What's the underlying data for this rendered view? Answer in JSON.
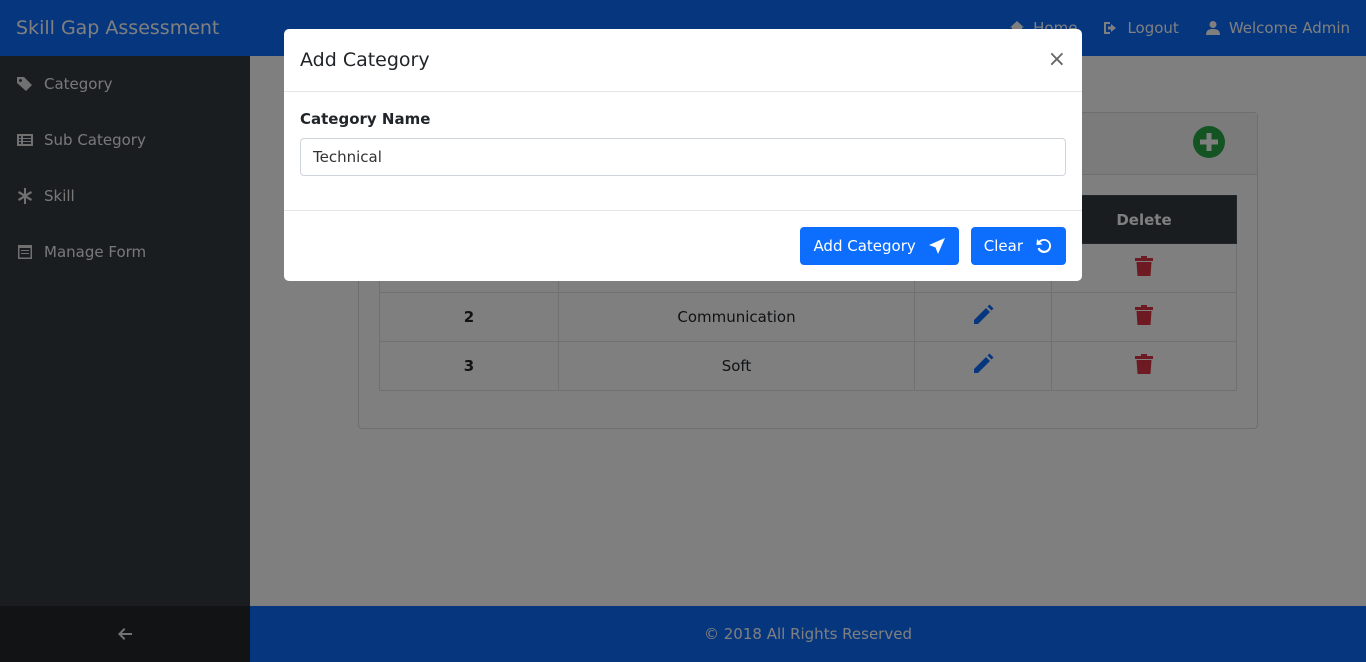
{
  "navbar": {
    "brand": "Skill Gap Assessment",
    "home_label": "Home",
    "logout_label": "Logout",
    "welcome_label": "Welcome Admin"
  },
  "sidebar": {
    "items": [
      {
        "label": "Category",
        "icon": "tags-icon"
      },
      {
        "label": "Sub Category",
        "icon": "list-icon"
      },
      {
        "label": "Skill",
        "icon": "asterisk-icon"
      },
      {
        "label": "Manage Form",
        "icon": "form-icon"
      }
    ],
    "collapse_icon": "arrow-left-icon"
  },
  "table": {
    "headers": [
      "",
      "",
      "",
      "Delete"
    ],
    "rows": [
      {
        "num": "2",
        "name": "Communication"
      },
      {
        "num": "3",
        "name": "Soft"
      }
    ]
  },
  "footer": {
    "text": "© 2018 All Rights Reserved"
  },
  "modal": {
    "title": "Add Category",
    "close_label": "×",
    "field_label": "Category Name",
    "field_value": "Technical",
    "submit_label": "Add Category",
    "clear_label": "Clear"
  },
  "colors": {
    "primary": "#0d6efd",
    "sidebar": "#343a40",
    "success": "#28a745",
    "danger": "#dc3545"
  }
}
